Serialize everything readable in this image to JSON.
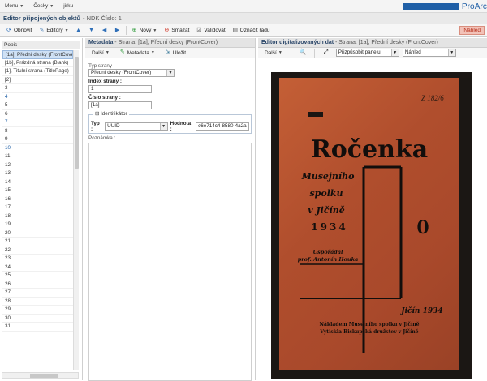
{
  "topbar": {
    "menu_items": [
      "Menu",
      "Česky",
      "jirku"
    ],
    "brand": "ProArc"
  },
  "title": {
    "main": "Editor připojených objektů",
    "sub": "- NDK Číslo: 1"
  },
  "toolbar": {
    "refresh": "Obnovit",
    "editors": "Editory",
    "new": "Nový",
    "delete": "Smazat",
    "validate": "Validovat",
    "mark_series": "Označit řadu",
    "preview": "Náhled"
  },
  "left_panel": {
    "column_header": "Popis",
    "rows": [
      "[1a], Přední desky (FrontCover)",
      "[1b], Prázdná strana (Blank)",
      "[1], Titulní strana (TitlePage)",
      "[2]",
      "3",
      "4",
      "5",
      "6",
      "7",
      "8",
      "9",
      "10",
      "11",
      "12",
      "13",
      "14",
      "15",
      "16",
      "17",
      "18",
      "19",
      "20",
      "21",
      "22",
      "23",
      "24",
      "25",
      "26",
      "27",
      "28",
      "29",
      "30",
      "31"
    ]
  },
  "metadata_panel": {
    "title": "Metadata",
    "subtitle": "- Strana: [1a], Přední desky (FrontCover)",
    "tool_more": "Další",
    "tool_metadata": "Metadata",
    "tool_save": "Uložit",
    "page_type_label": "Typ strany",
    "page_type_value": "Přední desky (FrontCover)",
    "page_index_label": "Index strany :",
    "page_index_value": "1",
    "page_number_label": "Číslo strany :",
    "page_number_value": "[1a]",
    "identifier_legend": "Identifikátor",
    "id_type_label": "Typ :",
    "id_type_value": "UUID",
    "id_value_label": "Hodnota :",
    "id_value": "c6e714c4-8580-4a2a-89c",
    "note_label": "Poznámka :"
  },
  "viewer_panel": {
    "title": "Editor digitalizovaných dat",
    "subtitle": "- Strana: [1a], Přední desky (FrontCover)",
    "tool_more": "Další",
    "fit_value": "Přizpůsobit panelu",
    "view_value": "Náhled"
  },
  "cover": {
    "title": "Ročenka",
    "subtitle_lines": [
      "Musejního",
      "spolku",
      "v Jičíně",
      "1934"
    ],
    "number": "0",
    "editor_lines": [
      "Uspořádal",
      "prof. Antonín Houka"
    ],
    "place_year": "Jičín 1934",
    "publisher_lines": [
      "Nákladem Musejního spolku v Jičíně",
      "Vytiskla Biskupská družstev v Jičíně"
    ],
    "handwritten": "Z 182/6"
  },
  "colors": {
    "accent": "#1f5fa6",
    "selection": "#cfe1f5",
    "cover": "#b4532e",
    "preview_button": "#f2c2b8"
  }
}
